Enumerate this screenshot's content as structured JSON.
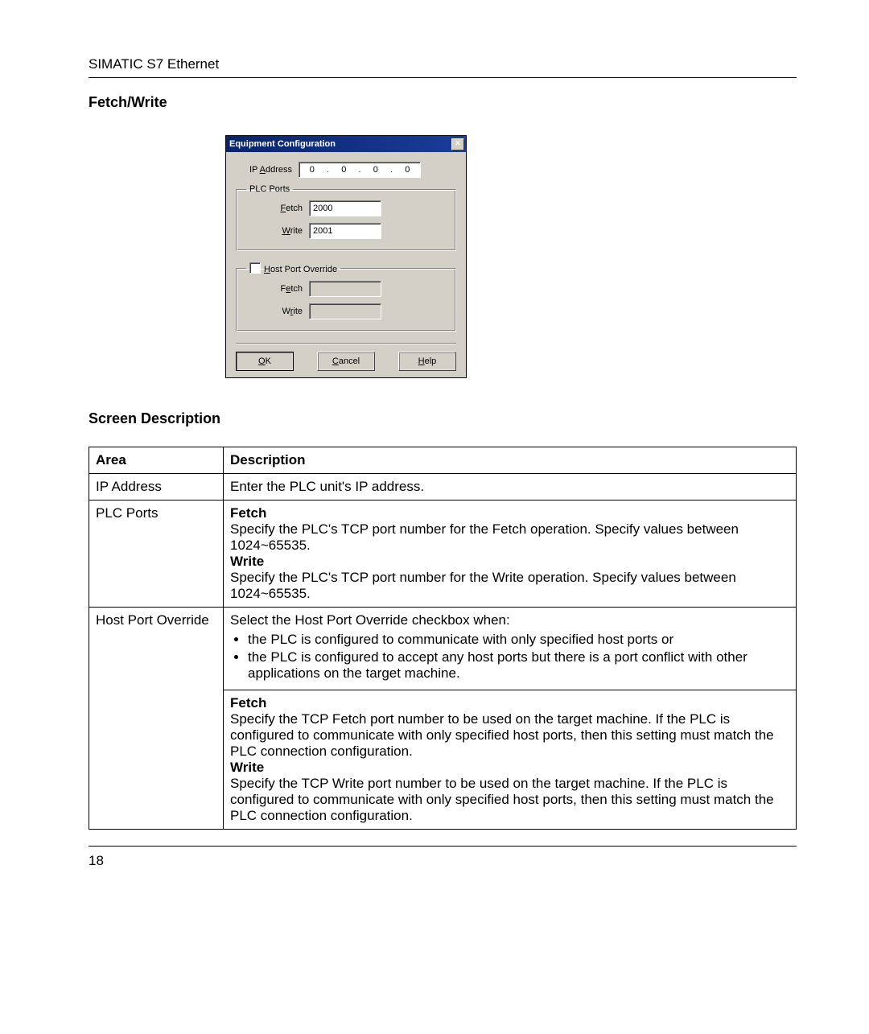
{
  "doc": {
    "header": "SIMATIC S7 Ethernet",
    "page_number": "18"
  },
  "sections": {
    "fetch_write": "Fetch/Write",
    "screen_desc": "Screen Description"
  },
  "dialog": {
    "title": "Equipment Configuration",
    "close_x": "×",
    "ip_label": "IP Address",
    "ip_hotkey": "A",
    "ip_octets": [
      "0",
      "0",
      "0",
      "0"
    ],
    "dot": ".",
    "plc_group": "PLC Ports",
    "plc_fetch_label": "Fetch",
    "plc_fetch_hot": "F",
    "plc_fetch_value": "2000",
    "plc_write_label": "Write",
    "plc_write_hot": "W",
    "plc_write_value": "2001",
    "host_group": "Host Port Override",
    "host_hot": "H",
    "host_fetch_label": "Fetch",
    "host_fetch_hot": "e",
    "host_fetch_value": "",
    "host_write_label": "Write",
    "host_write_hot": "r",
    "host_write_value": "",
    "ok": "OK",
    "ok_hot": "O",
    "cancel": "Cancel",
    "cancel_hot": "C",
    "help": "Help",
    "help_hot": "H"
  },
  "table": {
    "h_area": "Area",
    "h_desc": "Description",
    "rows": [
      {
        "area": "IP Address",
        "desc": "Enter the PLC unit's IP address."
      },
      {
        "area": "PLC Ports",
        "fetch_h": "Fetch",
        "fetch_t": "Specify the PLC's TCP port number for the Fetch operation. Specify values between 1024~65535.",
        "write_h": "Write",
        "write_t": "Specify the PLC's TCP port number for the Write operation. Specify values between 1024~65535."
      },
      {
        "area": "Host Port Override",
        "intro": "Select the Host Port Override checkbox when:",
        "b1": "the PLC is configured to communicate with only specified host ports or",
        "b2": "the PLC is configured to accept any host ports but there is a port conflict with other applications on the target machine.",
        "fetch_h": "Fetch",
        "fetch_t": "Specify the TCP Fetch port number to be used on the target machine. If the PLC is configured to communicate with only specified host ports, then this setting must match the PLC connection configuration.",
        "write_h": "Write",
        "write_t": "Specify the TCP Write port number to be used on the target machine. If the PLC is configured to communicate with only specified host ports, then this setting must match the PLC connection configuration."
      }
    ]
  }
}
